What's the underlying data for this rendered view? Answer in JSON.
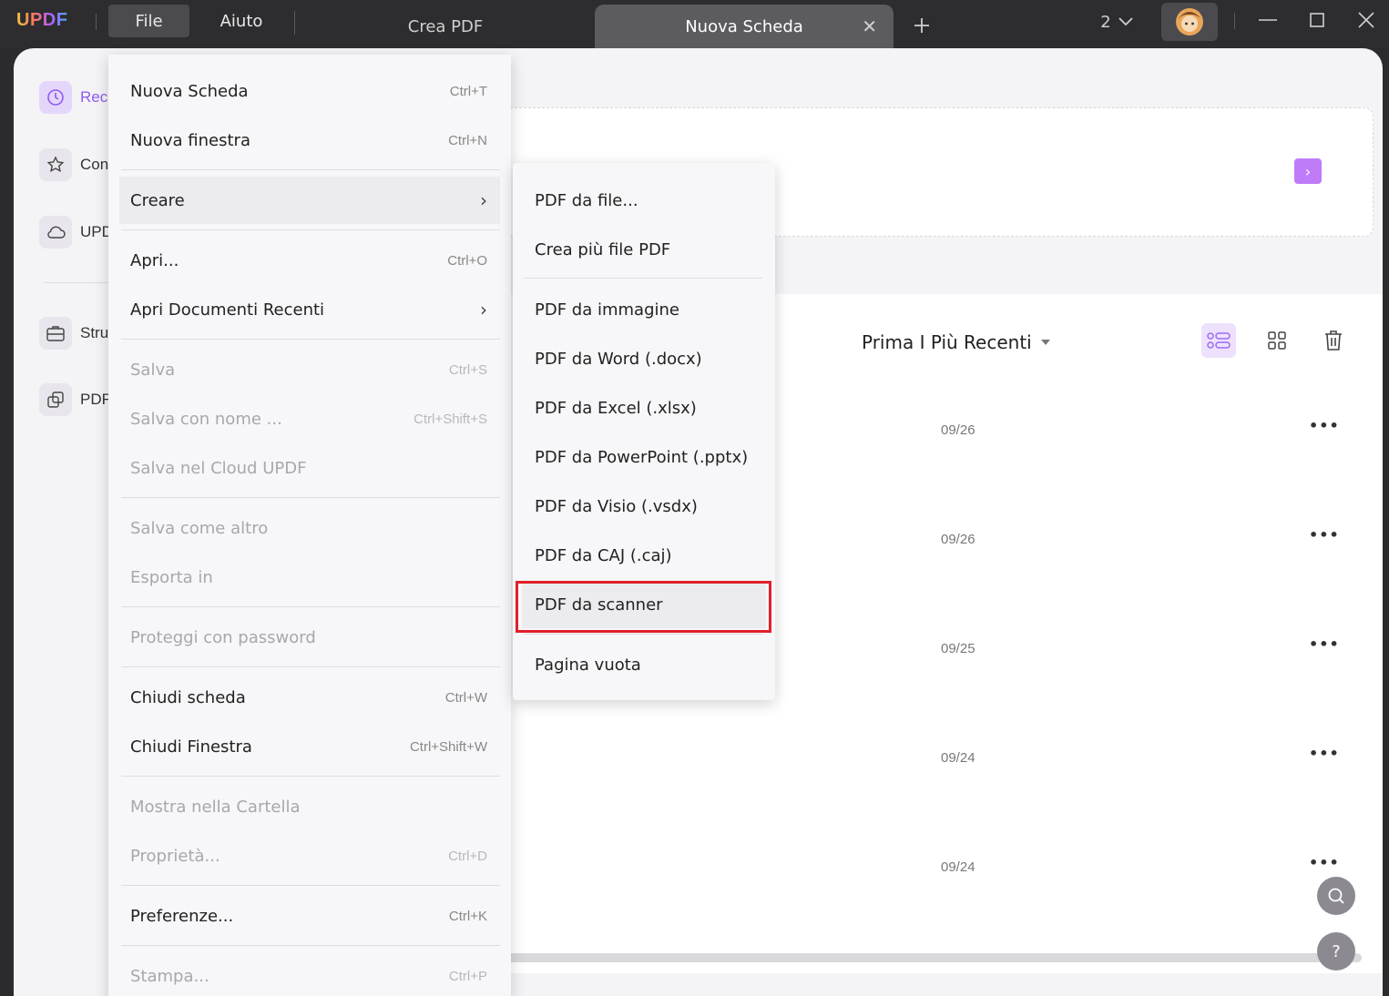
{
  "titlebar": {
    "logo": "UPDF",
    "menus": [
      "File",
      "Aiuto"
    ],
    "tabs": [
      {
        "label": "Crea PDF"
      },
      {
        "label": "Nuova Scheda"
      }
    ],
    "tab_count": "2"
  },
  "sidebar": {
    "items": [
      {
        "label": "Rece",
        "icon": "clock-icon"
      },
      {
        "label": "Con",
        "icon": "star-icon"
      },
      {
        "label": "UPD",
        "icon": "cloud-icon"
      },
      {
        "label": "Stru",
        "icon": "toolbox-icon"
      },
      {
        "label": "PDF",
        "icon": "copy-icon"
      }
    ]
  },
  "list": {
    "sort_label": "Prima I Più Recenti",
    "rows": [
      {
        "date": "09/26"
      },
      {
        "date": "09/26"
      },
      {
        "date": "09/25"
      },
      {
        "date": "09/24"
      },
      {
        "date": "09/24"
      }
    ]
  },
  "file_menu": {
    "items": [
      {
        "label": "Nuova Scheda",
        "shortcut": "Ctrl+T"
      },
      {
        "label": "Nuova finestra",
        "shortcut": "Ctrl+N"
      },
      {
        "label": "Creare",
        "shortcut": ""
      },
      {
        "label": "Apri...",
        "shortcut": "Ctrl+O"
      },
      {
        "label": "Apri Documenti Recenti",
        "shortcut": ""
      },
      {
        "label": "Salva",
        "shortcut": "Ctrl+S"
      },
      {
        "label": "Salva con nome ...",
        "shortcut": "Ctrl+Shift+S"
      },
      {
        "label": "Salva nel Cloud UPDF",
        "shortcut": ""
      },
      {
        "label": "Salva come altro",
        "shortcut": ""
      },
      {
        "label": "Esporta in",
        "shortcut": ""
      },
      {
        "label": "Proteggi con password",
        "shortcut": ""
      },
      {
        "label": "Chiudi scheda",
        "shortcut": "Ctrl+W"
      },
      {
        "label": "Chiudi Finestra",
        "shortcut": "Ctrl+Shift+W"
      },
      {
        "label": "Mostra nella Cartella",
        "shortcut": ""
      },
      {
        "label": "Proprietà...",
        "shortcut": "Ctrl+D"
      },
      {
        "label": "Preferenze...",
        "shortcut": "Ctrl+K"
      },
      {
        "label": "Stampa...",
        "shortcut": "Ctrl+P"
      }
    ]
  },
  "create_submenu": {
    "items": [
      "PDF da file...",
      "Crea più file PDF",
      "PDF da immagine",
      "PDF da Word (.docx)",
      "PDF da Excel (.xlsx)",
      "PDF da PowerPoint (.pptx)",
      "PDF da Visio (.vsdx)",
      "PDF da CAJ (.caj)",
      "PDF da scanner",
      "Pagina vuota"
    ]
  },
  "colors": {
    "accent": "#8e5cf0",
    "highlight_box": "#e0202a"
  }
}
